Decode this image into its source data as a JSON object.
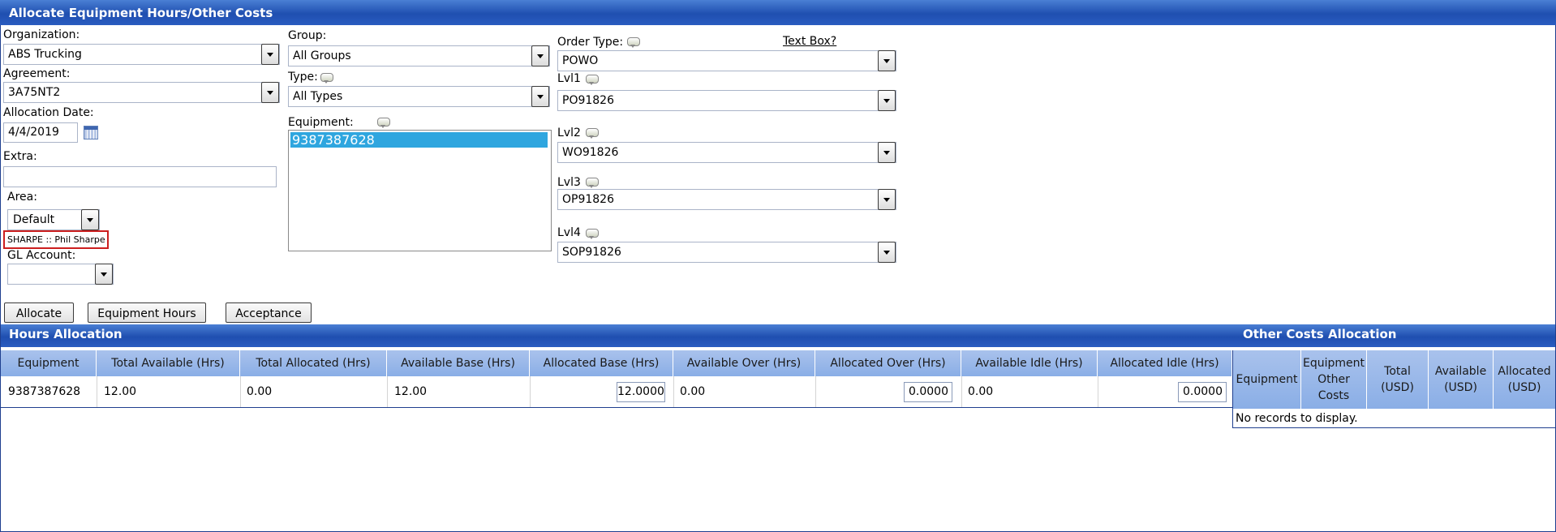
{
  "window": {
    "title": "Allocate Equipment Hours/Other Costs"
  },
  "form": {
    "organization": {
      "label": "Organization:",
      "value": "ABS Trucking"
    },
    "agreement": {
      "label": "Agreement:",
      "value": "3A75NT2"
    },
    "allocation_date": {
      "label": "Allocation Date:",
      "value": "4/4/2019"
    },
    "extra": {
      "label": "Extra:",
      "value": ""
    },
    "area": {
      "label": "Area:",
      "value": "Default"
    },
    "user_tag": "SHARPE :: Phil Sharpe",
    "gl_account": {
      "label": "GL Account:",
      "value": ""
    },
    "group": {
      "label": "Group:",
      "value": "All Groups"
    },
    "type": {
      "label": "Type:",
      "value": "All Types"
    },
    "equipment": {
      "label": "Equipment:",
      "items": [
        "9387387628"
      ]
    },
    "order_type": {
      "label": "Order Type:",
      "value": "POWO"
    },
    "text_box_link": "Text Box?",
    "lvl1": {
      "label": "Lvl1",
      "value": "PO91826"
    },
    "lvl2": {
      "label": "Lvl2",
      "value": "WO91826"
    },
    "lvl3": {
      "label": "Lvl3",
      "value": "OP91826"
    },
    "lvl4": {
      "label": "Lvl4",
      "value": "SOP91826"
    }
  },
  "buttons": {
    "allocate": "Allocate",
    "equipment_hours": "Equipment Hours",
    "acceptance": "Acceptance"
  },
  "hours_allocation": {
    "title": "Hours Allocation",
    "columns": [
      "Equipment",
      "Total Available (Hrs)",
      "Total Allocated (Hrs)",
      "Available Base (Hrs)",
      "Allocated Base (Hrs)",
      "Available Over (Hrs)",
      "Allocated Over (Hrs)",
      "Available Idle (Hrs)",
      "Allocated Idle (Hrs)"
    ],
    "rows": [
      {
        "equipment": "9387387628",
        "total_available": "12.00",
        "total_allocated": "0.00",
        "available_base": "12.00",
        "allocated_base": "12.0000",
        "available_over": "0.00",
        "allocated_over": "0.0000",
        "available_idle": "0.00",
        "allocated_idle": "0.0000"
      }
    ]
  },
  "other_costs_allocation": {
    "title": "Other Costs Allocation",
    "columns": [
      "Equipment",
      "Equipment Other Costs",
      "Total (USD)",
      "Available (USD)",
      "Allocated (USD)"
    ],
    "empty_text": "No records to display."
  },
  "colors": {
    "title_bar": "#1f4fb0",
    "grid_header": "#8aaee6",
    "selection": "#2fa6df",
    "highlight_border": "#cc1f1f"
  },
  "icons": [
    "dropdown-arrow-icon",
    "calendar-icon",
    "comment-bubble-icon"
  ]
}
